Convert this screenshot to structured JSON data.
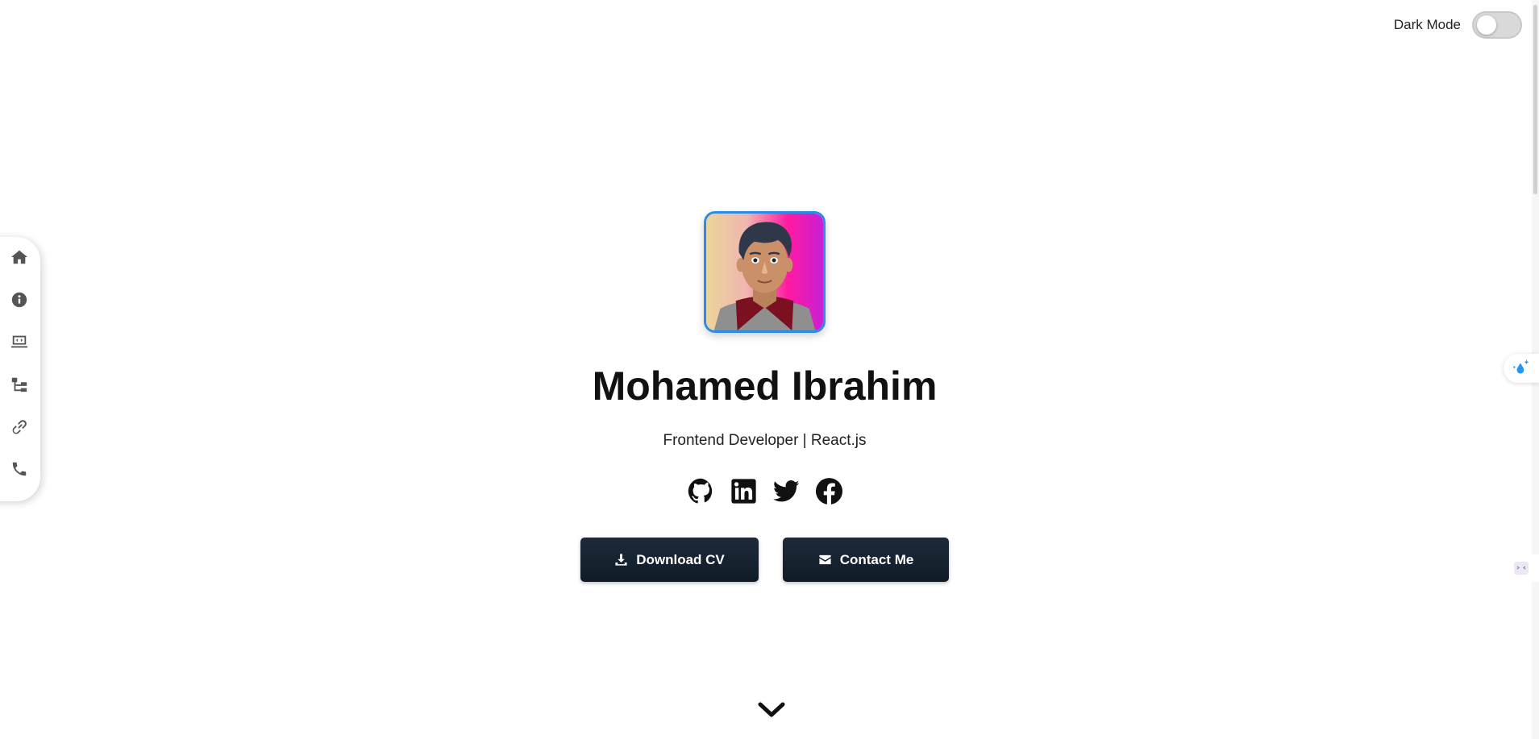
{
  "header": {
    "dark_mode_label": "Dark Mode"
  },
  "sidebar": {
    "items": [
      {
        "icon": "home-icon"
      },
      {
        "icon": "info-icon"
      },
      {
        "icon": "laptop-code-icon"
      },
      {
        "icon": "sitemap-icon"
      },
      {
        "icon": "link-icon"
      },
      {
        "icon": "phone-icon"
      }
    ]
  },
  "hero": {
    "name": "Mohamed Ibrahim",
    "tagline": "Frontend Developer | React.js",
    "socials": [
      {
        "icon": "github-icon"
      },
      {
        "icon": "linkedin-icon"
      },
      {
        "icon": "twitter-icon"
      },
      {
        "icon": "facebook-icon"
      }
    ],
    "download_cv_label": "Download CV",
    "contact_label": "Contact Me"
  },
  "colors": {
    "accent_border": "#2b8ce8",
    "button_bg": "#1a2533",
    "text": "#111111"
  }
}
